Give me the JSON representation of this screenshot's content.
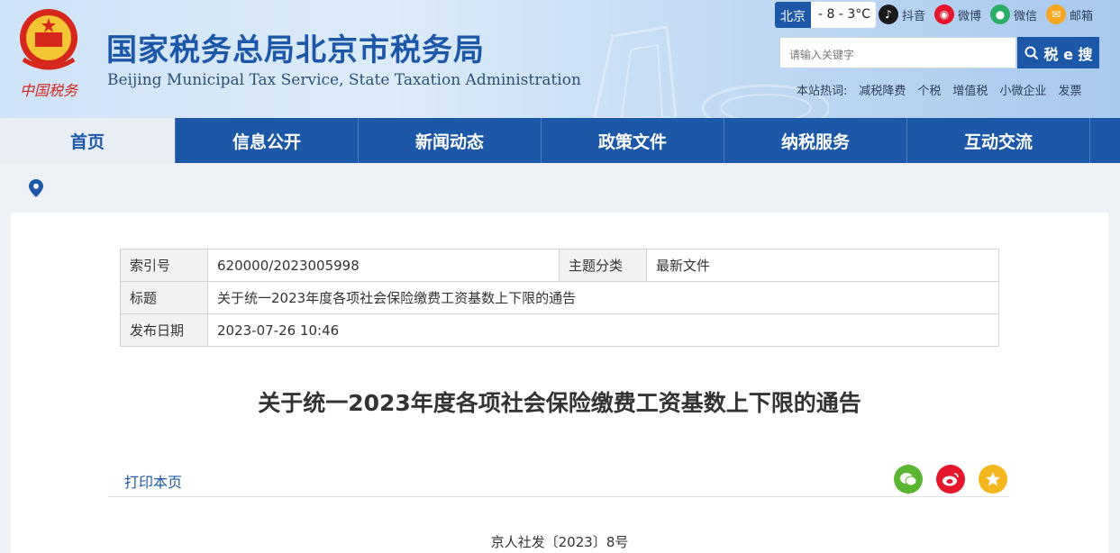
{
  "header": {
    "title": "国家税务总局北京市税务局",
    "subtitle": "Beijing Municipal Tax Service, State Taxation Administration",
    "emblem_text": "中国税务",
    "weather": {
      "city": "北京",
      "temp": "- 8 - 3°C"
    },
    "social": [
      {
        "label": "抖音",
        "icon": "douyin-icon",
        "color": "#1a1a1a"
      },
      {
        "label": "微博",
        "icon": "weibo-icon",
        "color": "#e6162d"
      },
      {
        "label": "微信",
        "icon": "wechat-icon",
        "color": "#2aae67"
      },
      {
        "label": "邮箱",
        "icon": "mail-icon",
        "color": "#f5a623"
      }
    ],
    "search": {
      "placeholder": "请输入关键字",
      "button_label": "税 e 搜"
    },
    "hot_links": {
      "label": "本站热词:",
      "items": [
        "减税降费",
        "个税",
        "增值税",
        "小微企业",
        "发票"
      ]
    }
  },
  "nav": {
    "items": [
      "首页",
      "信息公开",
      "新闻动态",
      "政策文件",
      "纳税服务",
      "互动交流"
    ],
    "active": 0
  },
  "meta": {
    "index_label": "索引号",
    "index_value": "620000/2023005998",
    "topic_label": "主题分类",
    "topic_value": "最新文件",
    "title_label": "标题",
    "title_value": "关于统一2023年度各项社会保险缴费工资基数上下限的通告",
    "date_label": "发布日期",
    "date_value": "2023-07-26 10:46"
  },
  "article": {
    "title": "关于统一2023年度各项社会保险缴费工资基数上下限的通告",
    "print_label": "打印本页",
    "doc_number": "京人社发〔2023〕8号"
  },
  "share": [
    {
      "icon": "wechat-share-icon",
      "color": "#5ab532"
    },
    {
      "icon": "weibo-share-icon",
      "color": "#e6162d"
    },
    {
      "icon": "favorite-icon",
      "color": "#f5b51d"
    }
  ],
  "colors": {
    "brand": "#1d58a8",
    "nav_active_bg": "#e9eef5"
  }
}
